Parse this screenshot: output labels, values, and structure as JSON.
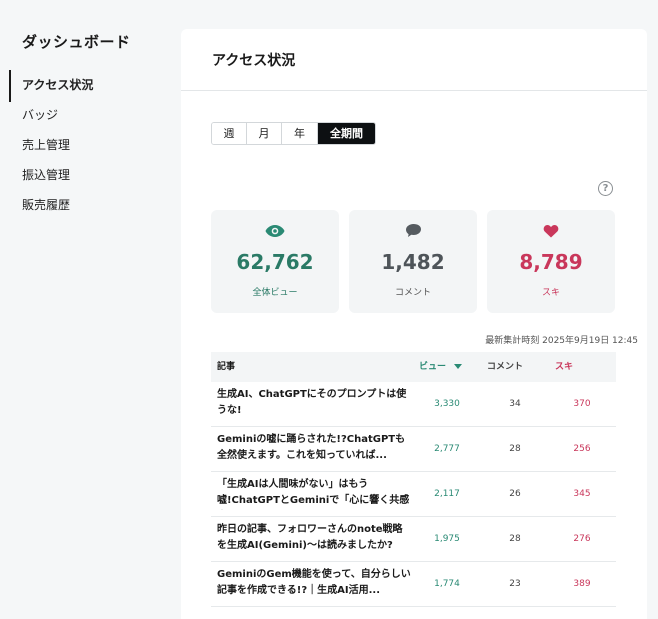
{
  "sidebar": {
    "title": "ダッシュボード",
    "items": [
      {
        "label": "アクセス状況",
        "active": true
      },
      {
        "label": "バッジ",
        "active": false
      },
      {
        "label": "売上管理",
        "active": false
      },
      {
        "label": "振込管理",
        "active": false
      },
      {
        "label": "販売履歴",
        "active": false
      }
    ]
  },
  "main": {
    "title": "アクセス状況",
    "periods": [
      "週",
      "月",
      "年",
      "全期間"
    ],
    "selected_period": "全期間",
    "help_label": "?",
    "stats": {
      "views": {
        "value": "62,762",
        "label": "全体ビュー",
        "icon": "eye-icon",
        "color": "#2a8a74"
      },
      "comments": {
        "value": "1,482",
        "label": "コメント",
        "icon": "comment-icon",
        "color": "#555b60"
      },
      "likes": {
        "value": "8,789",
        "label": "スキ",
        "icon": "heart-icon",
        "color": "#c9375b"
      }
    },
    "timestamp": "最新集計時刻 2025年9月19日 12:45",
    "table": {
      "headers": {
        "article": "記事",
        "views": "ビュー",
        "comments": "コメント",
        "likes": "スキ"
      },
      "rows": [
        {
          "title": "生成AI、ChatGPTにそのプロンプトは使うな!",
          "views": "3,330",
          "comments": "34",
          "likes": "370"
        },
        {
          "title": "Geminiの嘘に踊らされた!?ChatGPTも全然使えます。これを知っていれば...",
          "views": "2,777",
          "comments": "28",
          "likes": "256"
        },
        {
          "title": "「生成AIは人間味がない」はもう嘘!ChatGPTとGeminiで「心に響く共感表現」...",
          "views": "2,117",
          "comments": "26",
          "likes": "345"
        },
        {
          "title": "昨日の記事、フォロワーさんのnote戦略を生成AI(Gemini)〜は読みましたか?",
          "views": "1,975",
          "comments": "28",
          "likes": "276"
        },
        {
          "title": "GeminiのGem機能を使って、自分らしい記事を作成できる!?｜生成AI活用...",
          "views": "1,774",
          "comments": "23",
          "likes": "389"
        }
      ]
    }
  }
}
